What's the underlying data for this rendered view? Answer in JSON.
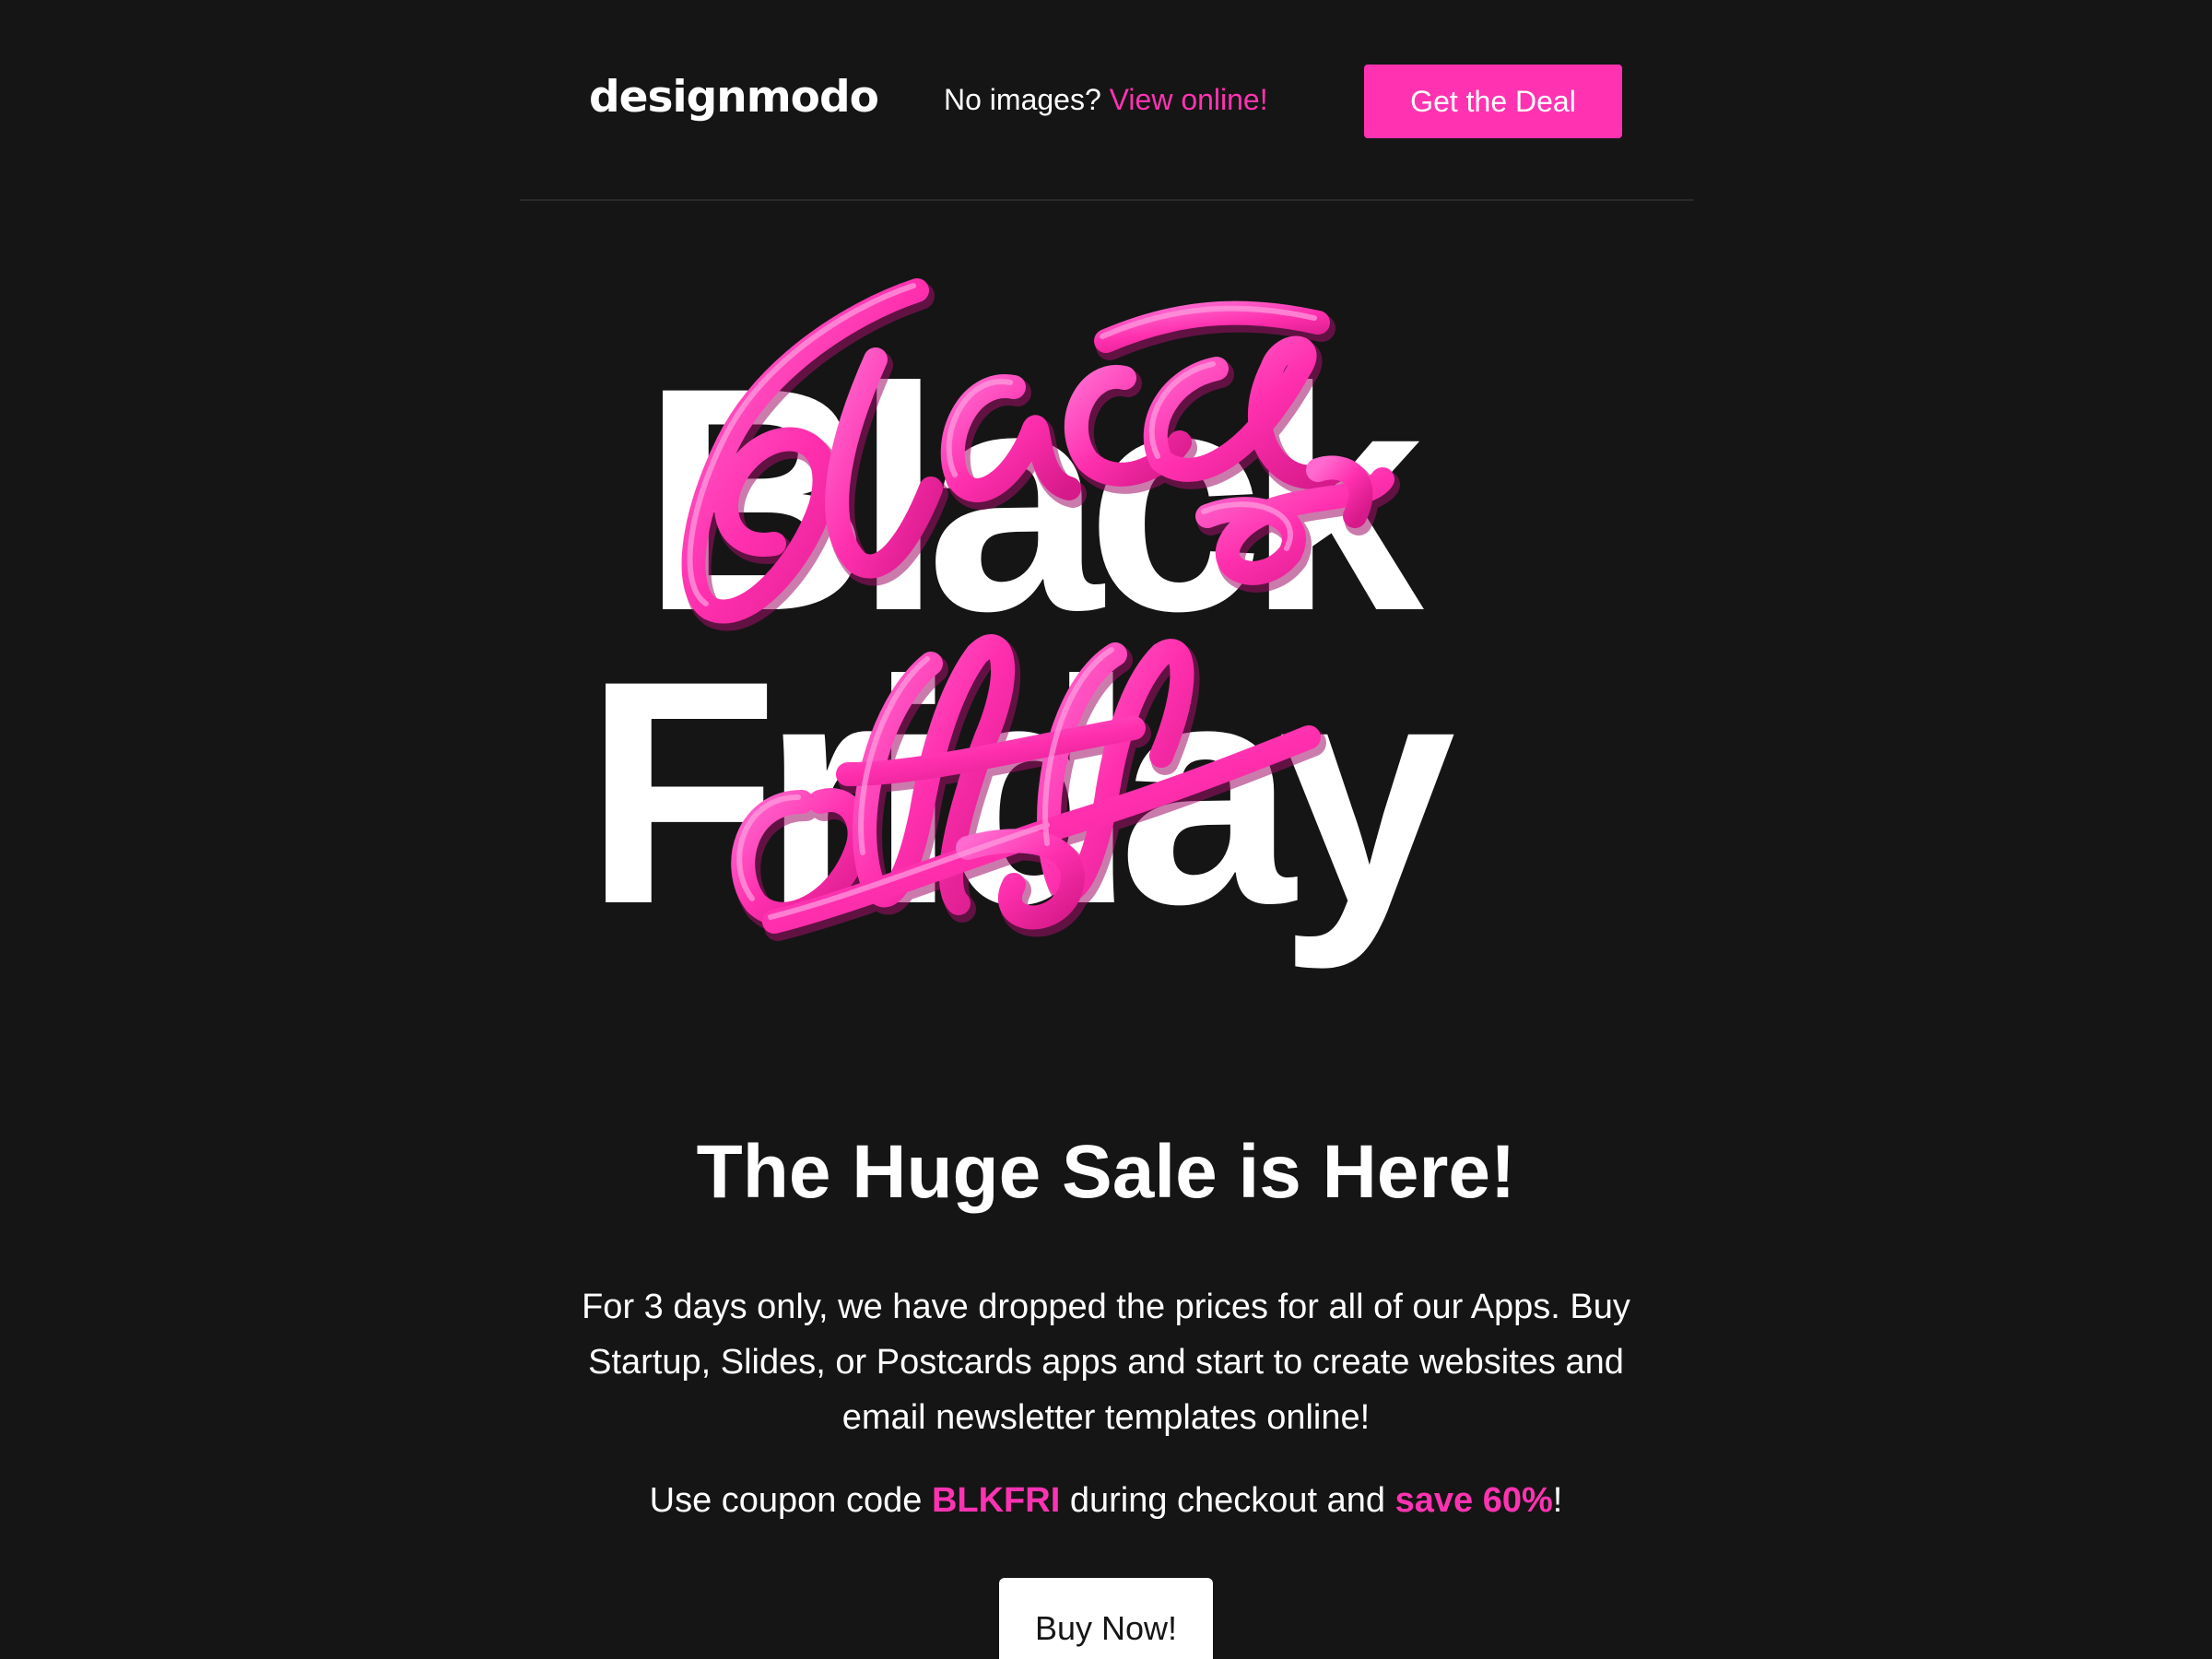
{
  "header": {
    "logo_text": "designmodo",
    "no_images_label": "No images?",
    "view_online_link": "View online!",
    "deal_button": "Get the Deal"
  },
  "hero": {
    "line1": "Black",
    "line2": "Friday",
    "script_overlay": "Black Friday",
    "colors": {
      "text": "#ffffff",
      "script": "#ff33b1"
    }
  },
  "content": {
    "headline": "The Huge Sale is Here!",
    "paragraph": "For 3 days only, we have dropped the prices for all of our Apps. Buy Startup, Slides, or Postcards apps and start to create websites and email newsletter templates online!",
    "coupon_prefix": "Use coupon code",
    "coupon_code": "BLKFRI",
    "coupon_middle": "during checkout and",
    "coupon_saving": "save 60%",
    "coupon_suffix": "!",
    "buy_button": "Buy Now!"
  },
  "colors": {
    "background": "#151515",
    "accent": "#ff33b1",
    "text": "#ffffff",
    "divider": "#2a2a2a"
  }
}
